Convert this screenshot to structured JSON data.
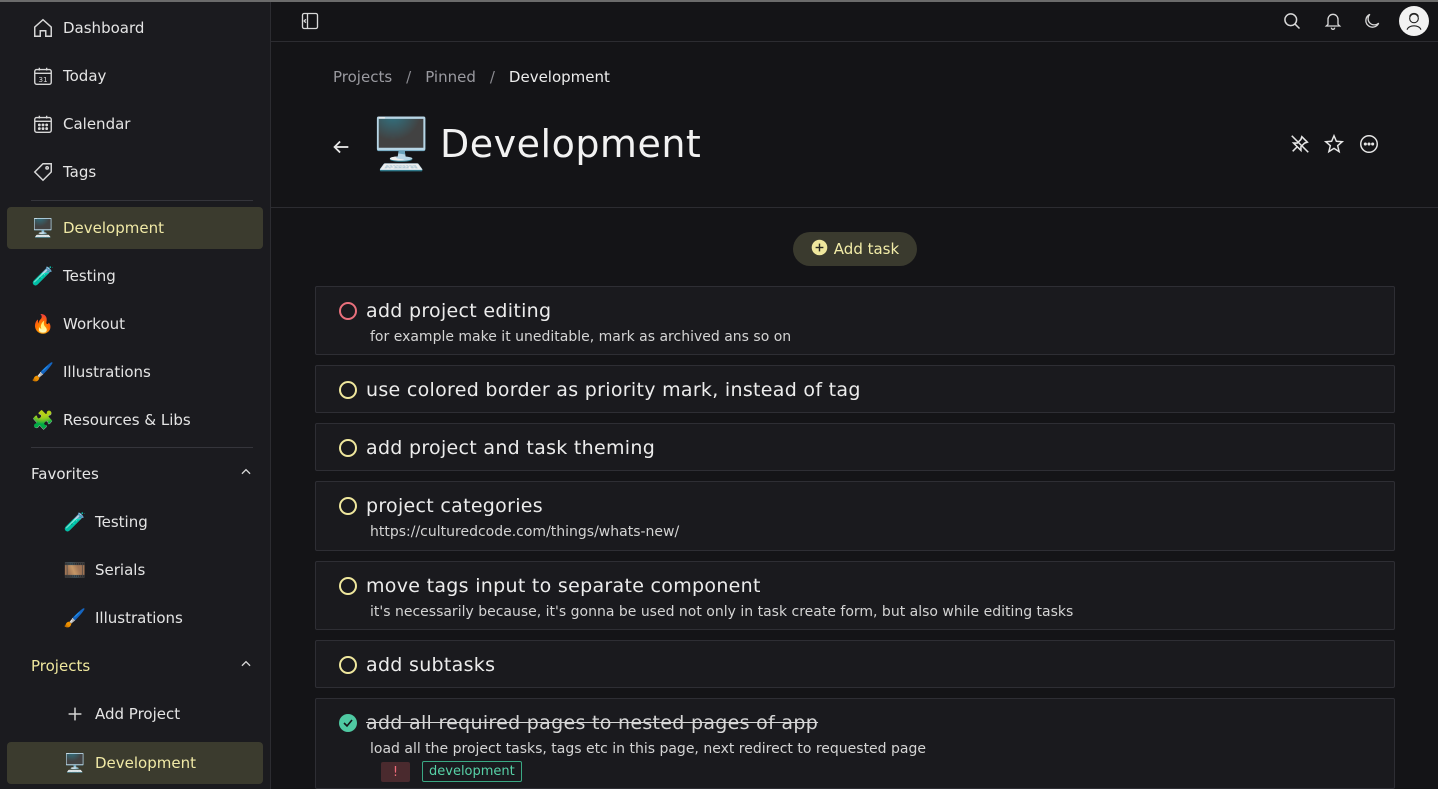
{
  "sidebar": {
    "main_nav": [
      {
        "label": "Dashboard",
        "icon": "home-icon"
      },
      {
        "label": "Today",
        "icon": "calendar-day-icon",
        "day": "31"
      },
      {
        "label": "Calendar",
        "icon": "calendar-icon"
      },
      {
        "label": "Tags",
        "icon": "tag-icon"
      }
    ],
    "pinned": [
      {
        "label": "Development",
        "emoji": "🖥️",
        "active": true
      },
      {
        "label": "Testing",
        "emoji": "🧪"
      },
      {
        "label": "Workout",
        "emoji": "🔥"
      },
      {
        "label": "Illustrations",
        "emoji": "🖌️"
      },
      {
        "label": "Resources & Libs",
        "emoji": "🧩"
      }
    ],
    "favorites": {
      "label": "Favorites",
      "items": [
        {
          "label": "Testing",
          "emoji": "🧪"
        },
        {
          "label": "Serials",
          "emoji": "🎞️"
        },
        {
          "label": "Illustrations",
          "emoji": "🖌️"
        }
      ]
    },
    "projects": {
      "label": "Projects",
      "add_label": "Add Project",
      "items": [
        {
          "label": "Development",
          "emoji": "🖥️",
          "active": true
        }
      ]
    }
  },
  "breadcrumb": [
    "Projects",
    "Pinned",
    "Development"
  ],
  "breadcrumb_sep": "/",
  "page": {
    "title": "Development",
    "emoji": "🖥️"
  },
  "add_task_label": "Add task",
  "tasks": [
    {
      "title": "add project editing",
      "desc": "for example make it uneditable, mark as archived ans so on",
      "state": "open",
      "priority_color": "#e9707c"
    },
    {
      "title": "use colored border as priority mark, instead of tag",
      "desc": "",
      "state": "open",
      "priority_color": "#efe79d"
    },
    {
      "title": "add project and task theming",
      "desc": "",
      "state": "open",
      "priority_color": "#efe79d"
    },
    {
      "title": "project categories",
      "desc": "https://culturedcode.com/things/whats-new/",
      "state": "open",
      "priority_color": "#efe79d"
    },
    {
      "title": "move tags input to separate component",
      "desc": "it's necessarily because, it's gonna be used not only in task create form, but also while editing tasks",
      "state": "open",
      "priority_color": "#efe79d"
    },
    {
      "title": "add subtasks",
      "desc": "",
      "state": "open",
      "priority_color": "#efe79d"
    },
    {
      "title": "add all required pages to nested pages of app",
      "desc": "load all the project tasks, tags etc in this page, next redirect to requested page",
      "state": "done",
      "priority_color": "#4fc9a2",
      "tags": [
        "!",
        "development"
      ]
    }
  ],
  "colors": {
    "accent": "#efe79d",
    "done": "#4fc9a2",
    "danger": "#e9707c",
    "active_bg": "#3b3b2e"
  }
}
